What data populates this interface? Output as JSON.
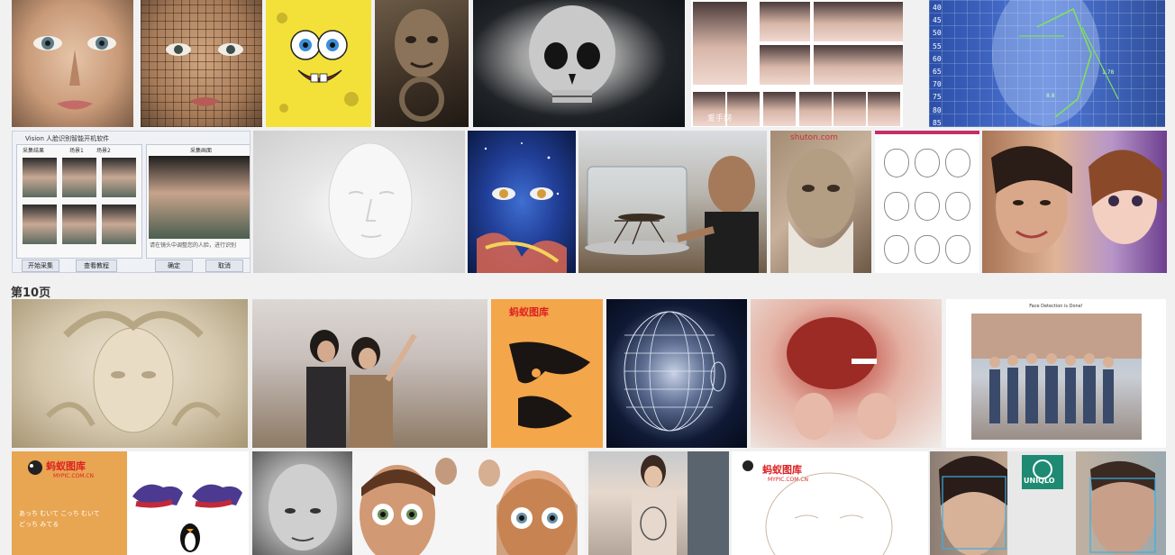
{
  "page_divider": {
    "label": "第10页"
  },
  "tiles": {
    "t6": {
      "watermark": "爱手网"
    },
    "t7": {
      "scale_marks": "40\n45\n50\n55\n60\n65\n70\n75\n80\n85",
      "labels": [
        "1.78",
        "8.8"
      ]
    },
    "t8": {
      "title": "Vision 人脸识别智能开机软件",
      "tab_capture": "采集结果",
      "tab_scene1": "场景1",
      "tab_scene2": "场景2",
      "tab_preview": "采集画面",
      "hint": "请在镜头中调整您的人脸，进行识别",
      "btn_start": "开始采集",
      "btn_tutorial": "查看教程",
      "btn_ok": "确定",
      "btn_cancel": "取消"
    },
    "t12": {
      "watermark": "shuton.com"
    },
    "t20": {
      "title": "Face Detection is Done!"
    },
    "t21": {
      "logo": "蚂蚁图库",
      "site": "MYPIC.COM.CN",
      "text_line1": "あっち むいて こっち むいて",
      "text_line2": "どっち みてる"
    },
    "t26": {
      "logo": "蚂蚁图库",
      "site": "MYPIC.COM.CN"
    },
    "t27": {
      "brand": "UNIQLO"
    }
  },
  "colors": {
    "background": "#f1f1f1",
    "spongebob_yellow": "#f3e13a",
    "face_grid_blue": "#3a62c2",
    "mypic_red": "#dd2222"
  }
}
